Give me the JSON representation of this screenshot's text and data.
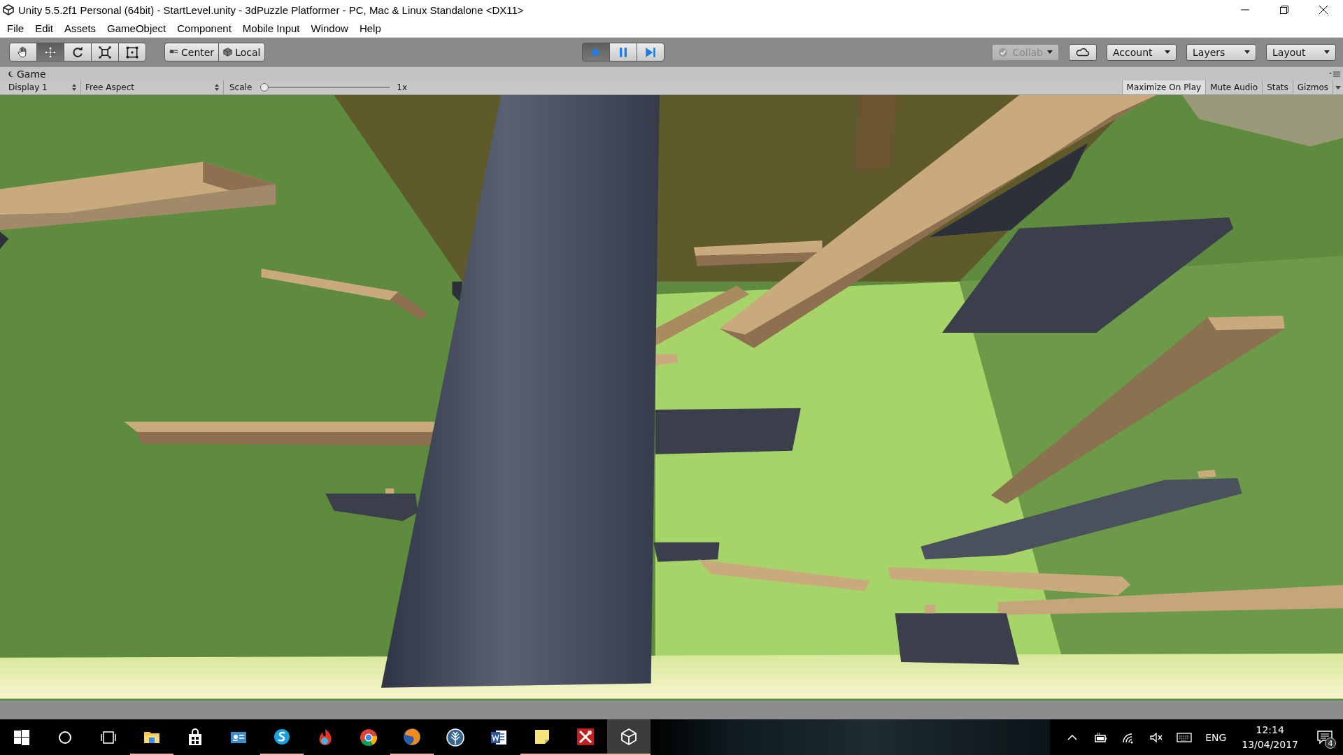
{
  "window": {
    "title": "Unity 5.5.2f1 Personal (64bit) - StartLevel.unity - 3dPuzzle Platformer - PC, Mac & Linux Standalone <DX11>"
  },
  "menu": [
    "File",
    "Edit",
    "Assets",
    "GameObject",
    "Component",
    "Mobile Input",
    "Window",
    "Help"
  ],
  "toolbar": {
    "tools": [
      {
        "kind": "hand",
        "selected": false
      },
      {
        "kind": "move",
        "selected": true
      },
      {
        "kind": "rotate",
        "selected": false
      },
      {
        "kind": "scale",
        "selected": false
      },
      {
        "kind": "rect",
        "selected": false
      }
    ],
    "pivot": [
      {
        "kind": "pivot",
        "label": "Center"
      },
      {
        "kind": "space",
        "label": "Local"
      }
    ],
    "playback": [
      {
        "kind": "play",
        "on": true
      },
      {
        "kind": "pause",
        "on": false
      },
      {
        "kind": "step",
        "on": false
      }
    ],
    "services": [
      {
        "kind": "collab",
        "label": "Collab",
        "disabled": true
      },
      {
        "kind": "cloud"
      },
      {
        "kind": "dropdown",
        "label": "Account"
      },
      {
        "kind": "dropdown",
        "label": "Layers"
      },
      {
        "kind": "dropdown",
        "label": "Layout"
      }
    ]
  },
  "game_panel": {
    "tab": "Game",
    "display": "Display 1",
    "aspect": "Free Aspect",
    "scale_label": "Scale",
    "scale": {
      "level": 0
    },
    "scale_value": "1x",
    "toggles": [
      {
        "label": "Maximize On Play",
        "on": true
      },
      {
        "label": "Mute Audio",
        "on": false
      },
      {
        "label": "Stats",
        "on": false
      },
      {
        "label": "Gizmos",
        "on": false
      }
    ]
  },
  "taskbar": {
    "apps": [
      {
        "kind": "explorer",
        "running": true,
        "active": false
      },
      {
        "kind": "store",
        "running": false,
        "active": false
      },
      {
        "kind": "card",
        "running": false,
        "active": false
      },
      {
        "kind": "chat",
        "running": true,
        "active": false
      },
      {
        "kind": "flame",
        "running": false,
        "active": false
      },
      {
        "kind": "chrome",
        "running": false,
        "active": false
      },
      {
        "kind": "firefox",
        "running": true,
        "active": false
      },
      {
        "kind": "tree",
        "running": false,
        "active": false
      },
      {
        "kind": "word",
        "running": false,
        "active": false
      },
      {
        "kind": "note",
        "running": true,
        "active": false
      },
      {
        "kind": "tools",
        "running": true,
        "active": false
      },
      {
        "kind": "unity",
        "running": true,
        "active": true
      }
    ],
    "tray": {
      "language": "ENG",
      "time": "12:14",
      "date": "13/04/2017",
      "notifications": "4"
    }
  }
}
